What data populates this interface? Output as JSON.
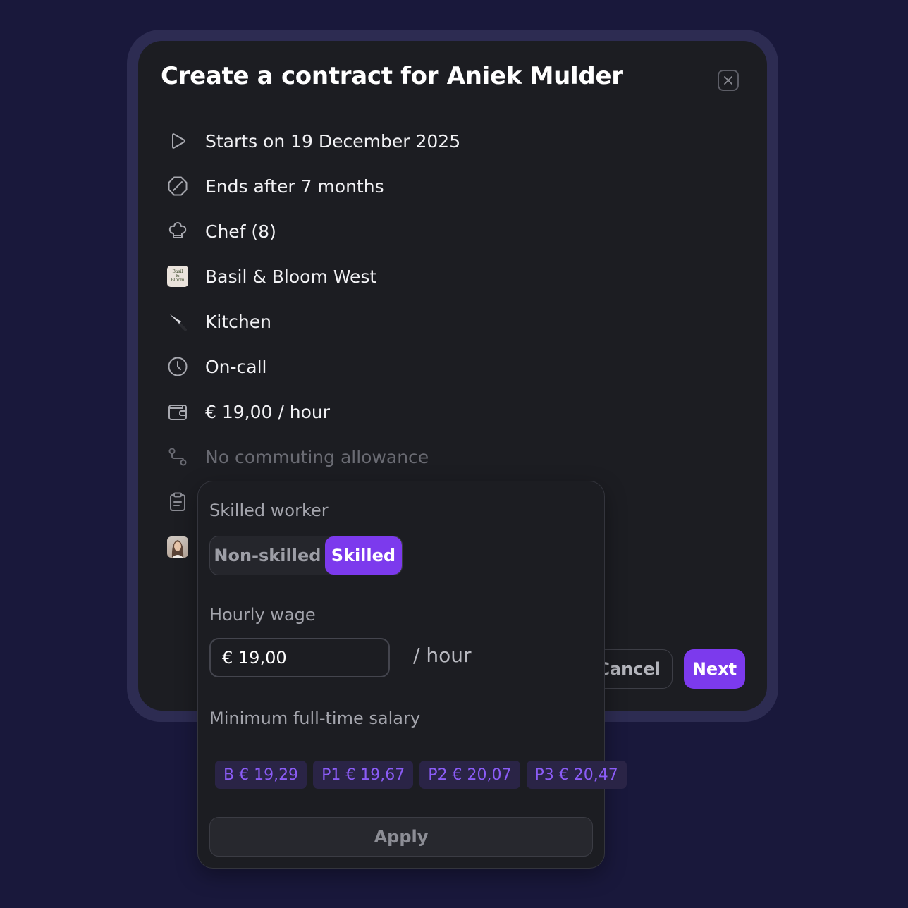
{
  "modal": {
    "title": "Create a contract for Aniek Mulder",
    "rows": [
      {
        "icon": "play-icon",
        "text": "Starts on 19 December 2025"
      },
      {
        "icon": "ban-icon",
        "text": "Ends after 7 months"
      },
      {
        "icon": "chef-hat-icon",
        "text": "Chef (8)"
      },
      {
        "icon": "restaurant-logo-icon",
        "text": "Basil & Bloom West",
        "logo_text": "Basil & Bloom"
      },
      {
        "icon": "knife-icon",
        "text": "Kitchen"
      },
      {
        "icon": "clock-icon",
        "text": "On-call"
      },
      {
        "icon": "wallet-icon",
        "text": "€ 19,00 / hour"
      },
      {
        "icon": "route-icon",
        "text": "No commuting allowance"
      },
      {
        "icon": "clipboard-icon",
        "text": ""
      },
      {
        "icon": "avatar",
        "text": ""
      }
    ],
    "cancel_label": "Cancel",
    "next_label": "Next"
  },
  "popover": {
    "skilled_label": "Skilled worker",
    "segment": {
      "options": [
        "Non-skilled",
        "Skilled"
      ],
      "selected": "Skilled"
    },
    "hourly_label": "Hourly wage",
    "hourly_value": "€ 19,00",
    "per_hour": "/ hour",
    "min_salary_label": "Minimum full-time salary",
    "chips": [
      "B € 19,29",
      "P1 € 19,67",
      "P2 € 20,07",
      "P3 € 20,47"
    ],
    "apply_label": "Apply"
  },
  "colors": {
    "background": "#19183b",
    "frame": "#2d2c52",
    "surface": "#1c1d22",
    "accent": "#7c3aed",
    "chip_text": "#8b5cf6",
    "muted": "#6a6b73"
  }
}
